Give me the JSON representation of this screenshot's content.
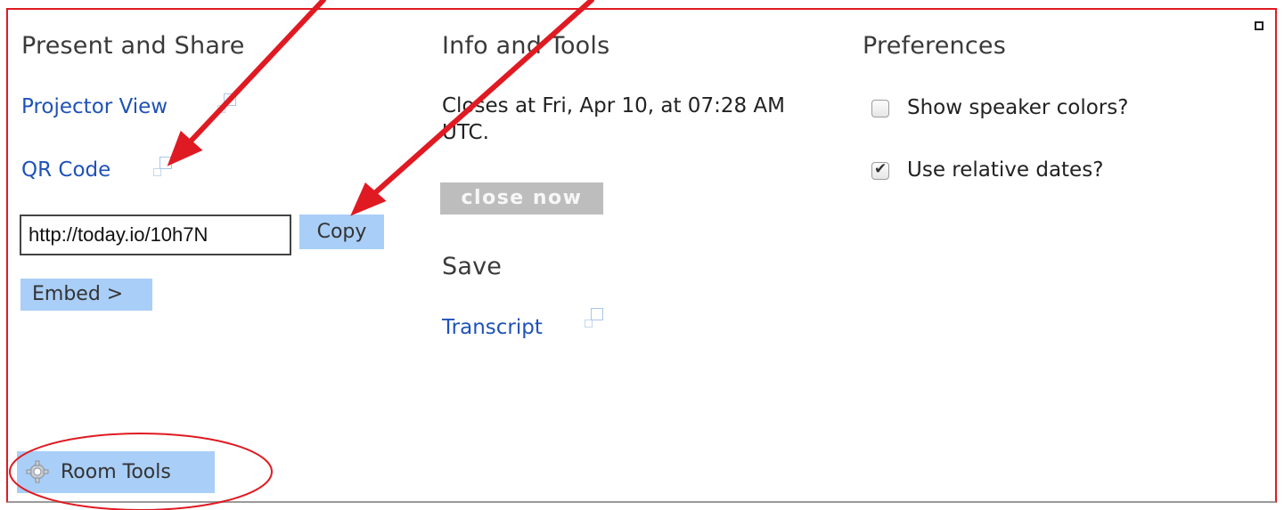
{
  "panel": {
    "present_share": {
      "heading": "Present and Share",
      "projector_view": "Projector View",
      "qr_code": "QR Code",
      "share_url": "http://today.io/10h7N",
      "copy_label": "Copy",
      "embed_label": "Embed >"
    },
    "info_tools": {
      "heading": "Info and Tools",
      "closes_text": "Closes at Fri, Apr 10, at 07:28 AM UTC.",
      "close_now_label": "close now",
      "save_heading": "Save",
      "transcript": "Transcript"
    },
    "preferences": {
      "heading": "Preferences",
      "options": [
        {
          "label": "Show speaker colors?",
          "checked": false
        },
        {
          "label": "Use relative dates?",
          "checked": true
        }
      ]
    },
    "room_tools_label": "Room Tools"
  },
  "colors": {
    "link": "#1f52b8",
    "button_bg": "#a9cef7",
    "annotation": "#e01a22"
  }
}
